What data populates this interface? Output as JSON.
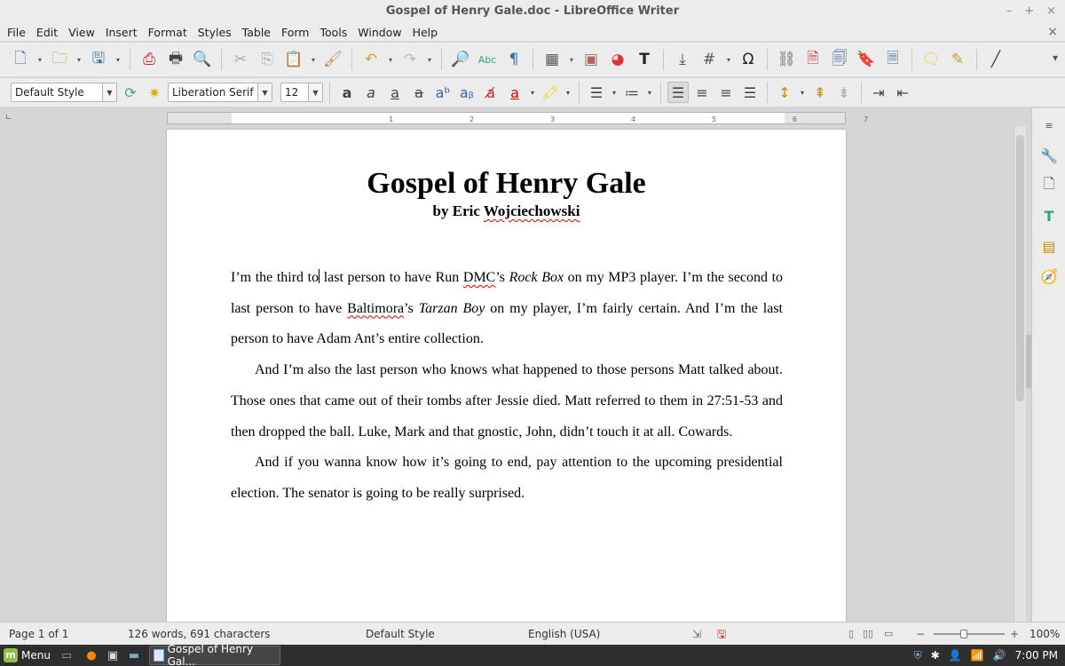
{
  "window": {
    "title": "Gospel of Henry Gale.doc - LibreOffice Writer",
    "controls": {
      "minimize": "–",
      "maximize": "+",
      "close": "×"
    }
  },
  "menubar": {
    "items": [
      "File",
      "Edit",
      "View",
      "Insert",
      "Format",
      "Styles",
      "Table",
      "Form",
      "Tools",
      "Window",
      "Help"
    ],
    "close_doc": "×"
  },
  "formatting": {
    "paragraph_style": "Default Style",
    "font_name": "Liberation Serif",
    "font_size": "12"
  },
  "ruler": {
    "ticks": [
      "1",
      "2",
      "3",
      "4",
      "5",
      "6",
      "7"
    ]
  },
  "document": {
    "title": "Gospel of Henry Gale",
    "author_prefix": "by Eric ",
    "author_name": "Wojciechowski",
    "p1": {
      "a": "I’m the third to",
      "b": " last person to have Run ",
      "dmc": "DMC",
      "c": "’s ",
      "rock_box": "Rock Box",
      "d": " on my MP3 player. I’m the second to last person to have ",
      "baltimora": "Baltimora",
      "e": "’s ",
      "tarzan_boy": "Tarzan Boy",
      "f": " on my player, I’m fairly certain. And I’m the last person to have Adam Ant’s entire collection."
    },
    "p2": "And I’m also the last person who knows what happened to those persons Matt talked about. Those ones that came out of their tombs after Jessie died. Matt referred to them in 27:51-53 and then dropped the ball. Luke, Mark and that gnostic, John, didn’t touch it at all. Cowards.",
    "p3": "And if you wanna know how it’s going to end, pay attention to the upcoming presidential election. The senator is going to be really surprised."
  },
  "statusbar": {
    "page": "Page 1 of 1",
    "word_count": "126 words, 691 characters",
    "style": "Default Style",
    "language": "English (USA)",
    "zoom_minus": "−",
    "zoom_plus": "+",
    "zoom": "100%"
  },
  "taskbar": {
    "menu_label": "Menu",
    "task": "Gospel of Henry Gal...",
    "clock": "7:00 PM"
  }
}
